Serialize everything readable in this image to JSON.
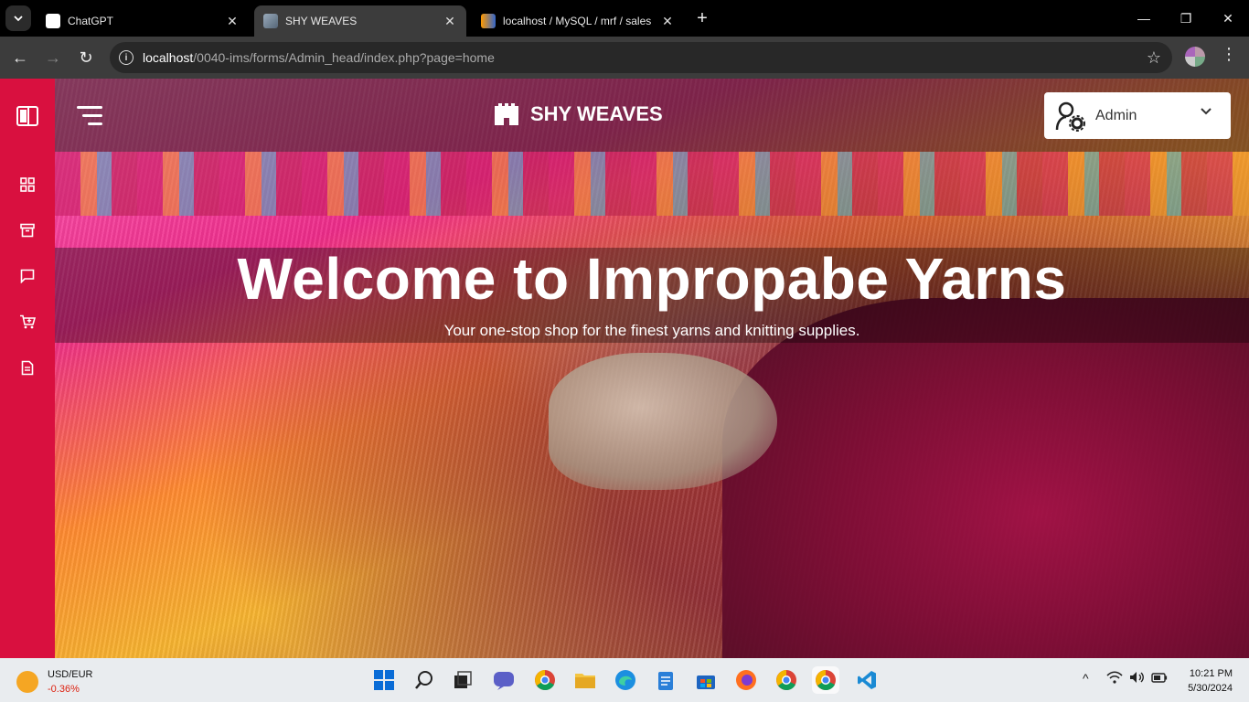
{
  "browser": {
    "tabs": [
      {
        "title": "ChatGPT",
        "active": false
      },
      {
        "title": "SHY WEAVES",
        "active": true
      },
      {
        "title": "localhost / MySQL / mrf / sales",
        "active": false
      }
    ],
    "url_host": "localhost",
    "url_path": "/0040-ims/forms/Admin_head/index.php?page=home"
  },
  "sidebar": {
    "accent_color": "#d9103f",
    "items": [
      {
        "icon": "sidebar-toggle-icon"
      },
      {
        "icon": "dashboard-grid-icon"
      },
      {
        "icon": "archive-icon"
      },
      {
        "icon": "message-icon"
      },
      {
        "icon": "cart-icon"
      },
      {
        "icon": "document-icon"
      }
    ]
  },
  "header": {
    "brand": "SHY WEAVES",
    "user": "Admin"
  },
  "hero": {
    "title": "Welcome to Impropabe Yarns",
    "subtitle": "Your one-stop shop for the finest yarns and knitting supplies."
  },
  "taskbar": {
    "ticker_name": "USD/EUR",
    "ticker_change": "-0.36%",
    "time": "10:21 PM",
    "date": "5/30/2024"
  }
}
